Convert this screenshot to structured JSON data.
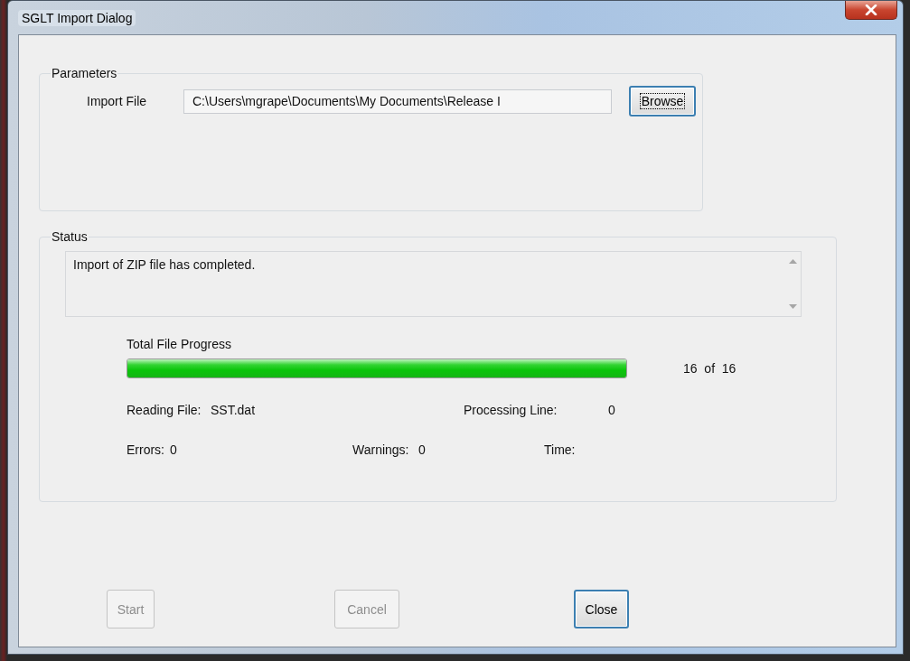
{
  "window": {
    "title": "SGLT Import Dialog"
  },
  "parameters": {
    "title": "Parameters",
    "import_file": {
      "label": "Import File",
      "value": "C:\\Users\\mgrape\\Documents\\My Documents\\Release I"
    },
    "browse_button": {
      "label": "Browse",
      "focused": true
    }
  },
  "status": {
    "title": "Status",
    "message": "Import of ZIP file has completed.",
    "progress": {
      "label": "Total File Progress",
      "level": 1,
      "count": "16  of  16"
    },
    "reading_file": {
      "label": "Reading File:",
      "value": "SST.dat"
    },
    "processing_line": {
      "label": "Processing Line:",
      "value": "0"
    },
    "errors": {
      "label": "Errors:",
      "value": "0"
    },
    "warnings": {
      "label": "Warnings:",
      "value": "0"
    },
    "time": {
      "label": "Time:"
    }
  },
  "buttons": [
    {
      "label": "Start",
      "disabled": true,
      "focused": false
    },
    {
      "label": "Cancel",
      "disabled": true,
      "focused": false
    },
    {
      "label": "Close",
      "disabled": false,
      "focused": true
    }
  ]
}
